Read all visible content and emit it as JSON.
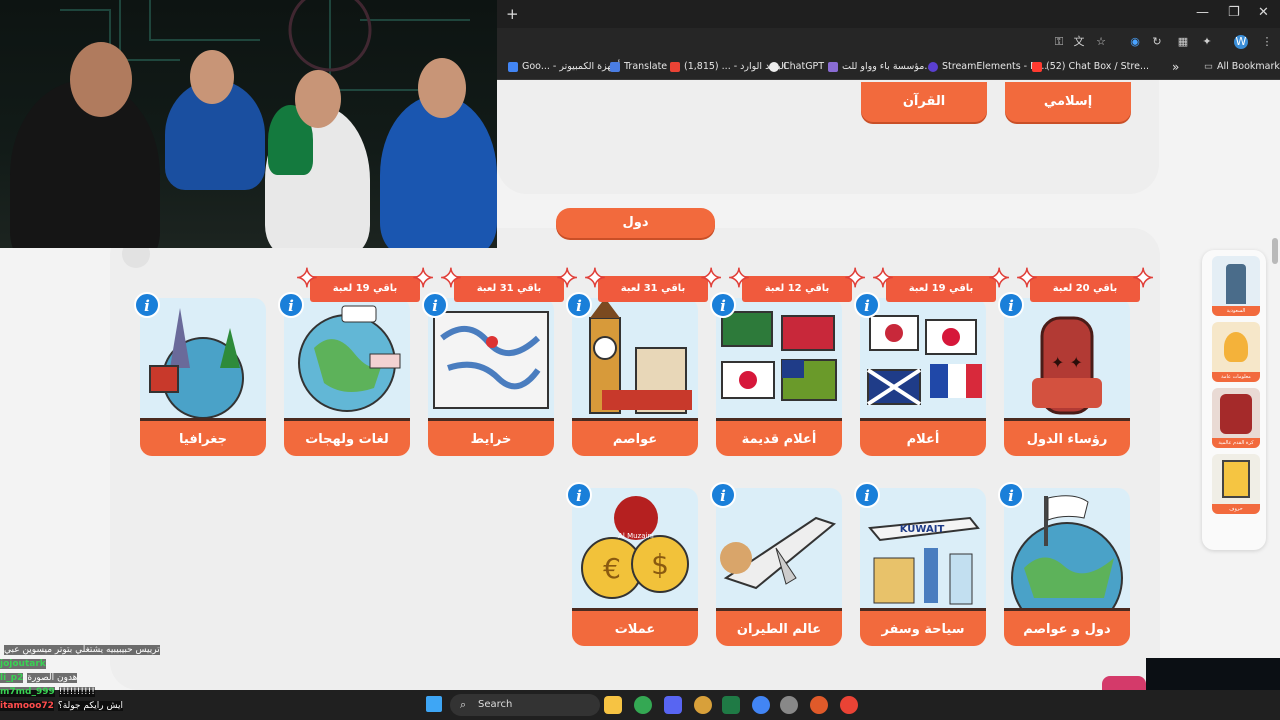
{
  "browser": {
    "new_tab": "+",
    "window_controls": [
      "—",
      "❐",
      "✕"
    ],
    "bookmarks": [
      {
        "label": "Goo... - أجهزة الكمبيوتر",
        "color": "#4285f4"
      },
      {
        "label": "Translate",
        "color": "#4a7de2"
      },
      {
        "label": "البريد الوارد - ... (1,815)",
        "color": "#ea4335"
      },
      {
        "label": "ChatGPT",
        "color": "#ffffff"
      },
      {
        "label": "مؤسسة باء وواو للت...",
        "color": "#8a6cd4"
      },
      {
        "label": "StreamElements - M...",
        "color": "#5a3fd0"
      },
      {
        "label": "(52) Chat Box / Stre...",
        "color": "#ff3b30"
      }
    ],
    "all_bookmarks": "All Bookmarks",
    "chevron": "»"
  },
  "top_section": {
    "cards": [
      {
        "label": "إسلامي"
      },
      {
        "label": "القرآن"
      }
    ]
  },
  "category": {
    "title": "دول"
  },
  "row1": [
    {
      "label": "رؤساء الدول",
      "badge": "باقي 20 لعبة",
      "art": "throne"
    },
    {
      "label": "أعلام",
      "badge": "باقي 19 لعبة",
      "art": "flags"
    },
    {
      "label": "أعلام قديمة",
      "badge": "باقي 12 لعبة",
      "art": "oldflags"
    },
    {
      "label": "عواصم",
      "badge": "باقي 31 لعبة",
      "art": "capitals"
    },
    {
      "label": "خرايط",
      "badge": "باقي 31 لعبة",
      "art": "map"
    },
    {
      "label": "لغات ولهجات",
      "badge": "باقي 19 لعبة",
      "art": "globe"
    },
    {
      "label": "جغرافيا",
      "badge": "",
      "art": "geo"
    }
  ],
  "row2": [
    {
      "label": "دول و عواصم",
      "art": "world"
    },
    {
      "label": "سياحة وسفر",
      "art": "kuwait",
      "art_text": "KUWAIT"
    },
    {
      "label": "عالم الطيران",
      "art": "plane"
    },
    {
      "label": "عملات",
      "art": "coins",
      "art_text": "Al Muzaini"
    }
  ],
  "info_glyph": "i",
  "sidebar": {
    "items": [
      {
        "label": "السعودية"
      },
      {
        "label": "معلومات عامة"
      },
      {
        "label": "كرة القدم عالمية"
      },
      {
        "label": "حروف"
      }
    ]
  },
  "chat": [
    {
      "user": "",
      "text": "ترييس حبيبيبيه يشتغلي بتوتر ميسوين عبي",
      "color": "#cfcfcf"
    },
    {
      "user": "jojoutark",
      "text": "",
      "color": "#39d353"
    },
    {
      "user": "li_p2",
      "text": "هدون الصورة",
      "color": "#39d353"
    },
    {
      "user": "m7md_999",
      "text": "!!!!!!!!!!",
      "color": "#39d353"
    },
    {
      "user": "itamooo72",
      "text": "ايش رايكم جولة؟",
      "color": "#ff4d4d"
    }
  ],
  "taskbar": {
    "search": "Search"
  }
}
